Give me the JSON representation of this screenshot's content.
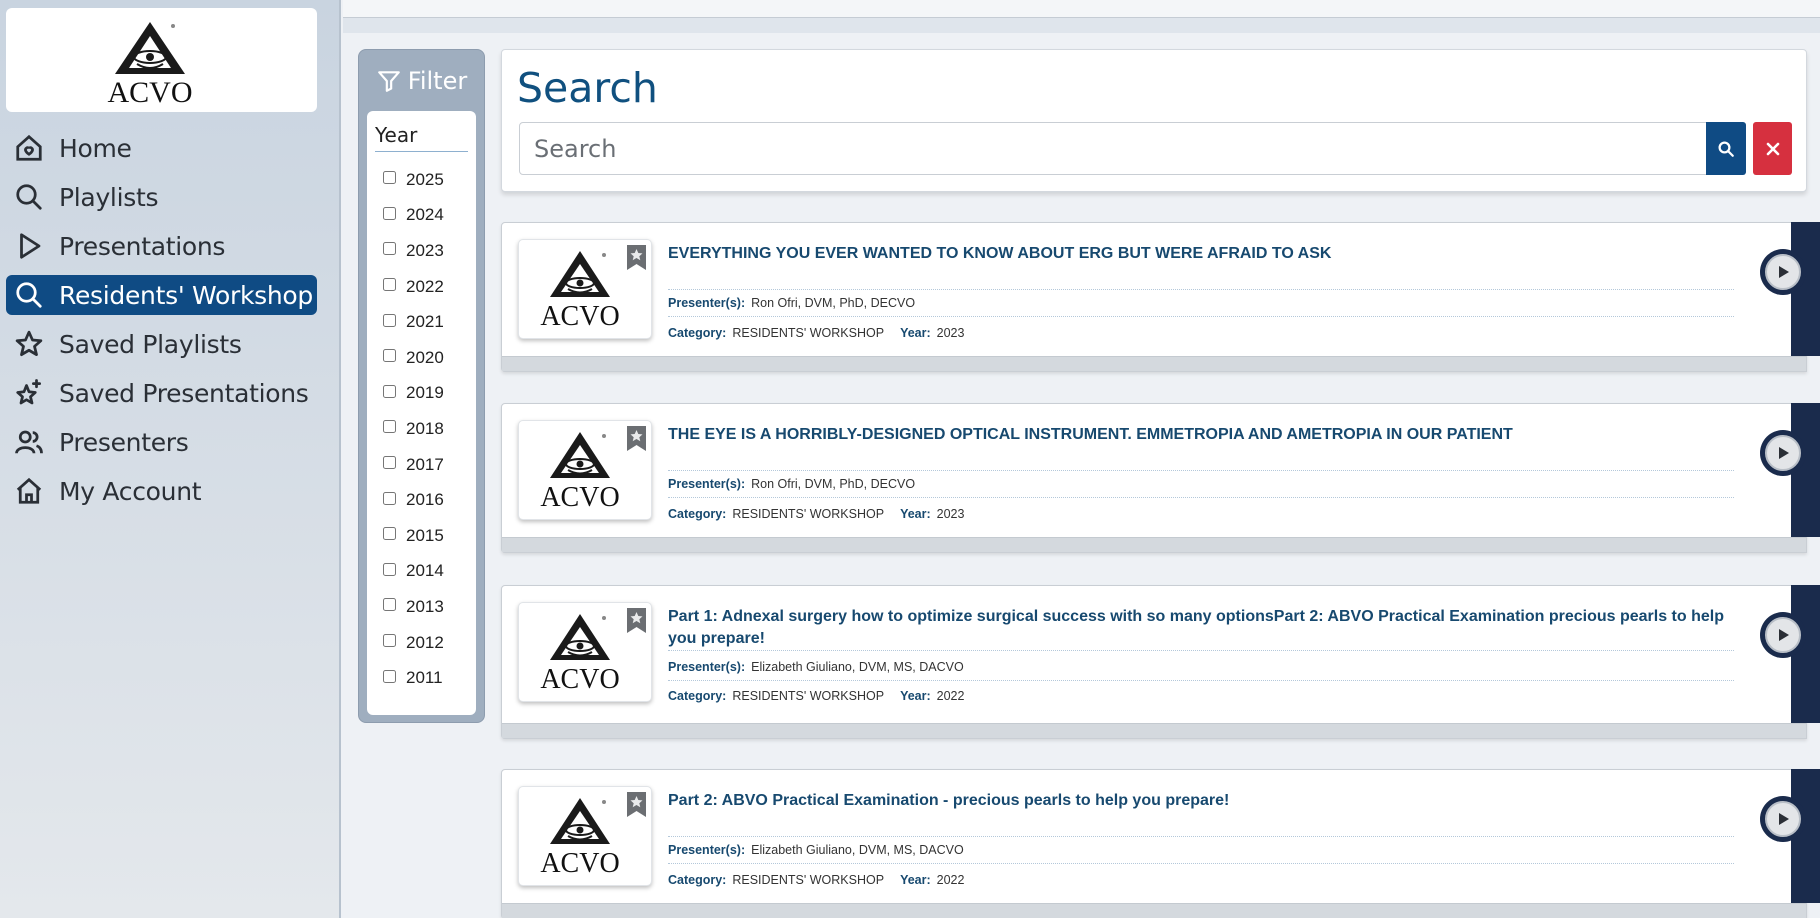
{
  "brand": {
    "logo_text": "ACVO"
  },
  "sidebar": {
    "items": [
      {
        "label": "Home",
        "icon": "home-heart-icon",
        "active": false
      },
      {
        "label": "Playlists",
        "icon": "search-icon",
        "active": false
      },
      {
        "label": "Presentations",
        "icon": "play-outline-icon",
        "active": false
      },
      {
        "label": "Residents' Workshop",
        "icon": "search-icon",
        "active": true
      },
      {
        "label": "Saved Playlists",
        "icon": "star-icon",
        "active": false
      },
      {
        "label": "Saved Presentations",
        "icon": "sparkle-star-icon",
        "active": false
      },
      {
        "label": "Presenters",
        "icon": "people-icon",
        "active": false
      },
      {
        "label": "My Account",
        "icon": "house-icon",
        "active": false
      }
    ]
  },
  "filter": {
    "title": "Filter",
    "year_heading": "Year",
    "years": [
      "2025",
      "2024",
      "2023",
      "2022",
      "2021",
      "2020",
      "2019",
      "2018",
      "2017",
      "2016",
      "2015",
      "2014",
      "2013",
      "2012",
      "2011"
    ]
  },
  "search": {
    "title": "Search",
    "placeholder": "Search"
  },
  "results": [
    {
      "title": "EVERYTHING YOU EVER WANTED TO KNOW ABOUT ERG BUT WERE AFRAID TO ASK",
      "presenter_label": "Presenter(s):",
      "presenter": "Ron Ofri, DVM, PhD, DECVO",
      "category_label": "Category:",
      "category": "RESIDENTS' WORKSHOP",
      "year_label": "Year:",
      "year": "2023"
    },
    {
      "title": "THE EYE IS A HORRIBLY-DESIGNED OPTICAL INSTRUMENT. EMMETROPIA AND AMETROPIA IN OUR PATIENT",
      "presenter_label": "Presenter(s):",
      "presenter": "Ron Ofri, DVM, PhD, DECVO",
      "category_label": "Category:",
      "category": "RESIDENTS' WORKSHOP",
      "year_label": "Year:",
      "year": "2023"
    },
    {
      "title": "Part 1: Adnexal surgery how to optimize surgical success with so many optionsPart 2: ABVO Practical Examination precious pearls to help you prepare!",
      "presenter_label": "Presenter(s):",
      "presenter": "Elizabeth Giuliano, DVM, MS, DACVO",
      "category_label": "Category:",
      "category": "RESIDENTS' WORKSHOP",
      "year_label": "Year:",
      "year": "2022"
    },
    {
      "title": "Part 2: ABVO Practical Examination - precious pearls to help you prepare!",
      "presenter_label": "Presenter(s):",
      "presenter": "Elizabeth Giuliano, DVM, MS, DACVO",
      "category_label": "Category:",
      "category": "RESIDENTS' WORKSHOP",
      "year_label": "Year:",
      "year": "2022"
    }
  ],
  "colors": {
    "primary": "#0f4b84",
    "danger": "#d6303f",
    "title_text": "#17496f",
    "dark_accent": "#1a2b4c"
  }
}
